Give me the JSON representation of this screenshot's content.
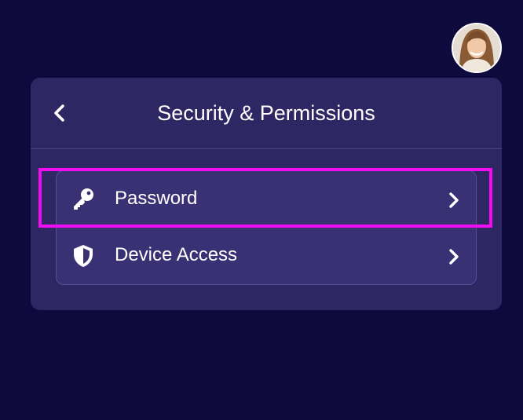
{
  "header": {
    "title": "Security & Permissions",
    "back_icon": "chevron-left-icon"
  },
  "user": {
    "avatar_icon": "avatar-photo"
  },
  "menu": {
    "items": [
      {
        "label": "Password",
        "icon": "key-icon",
        "chevron": "chevron-right-icon",
        "highlighted": true
      },
      {
        "label": "Device Access",
        "icon": "shield-icon",
        "chevron": "chevron-right-icon",
        "highlighted": false
      }
    ]
  },
  "colors": {
    "background": "#0e0a3d",
    "panel": "#2f2764",
    "menu_list": "#393173",
    "divider": "#4c4590",
    "highlight": "#f20cf2",
    "text": "#ffffff"
  }
}
